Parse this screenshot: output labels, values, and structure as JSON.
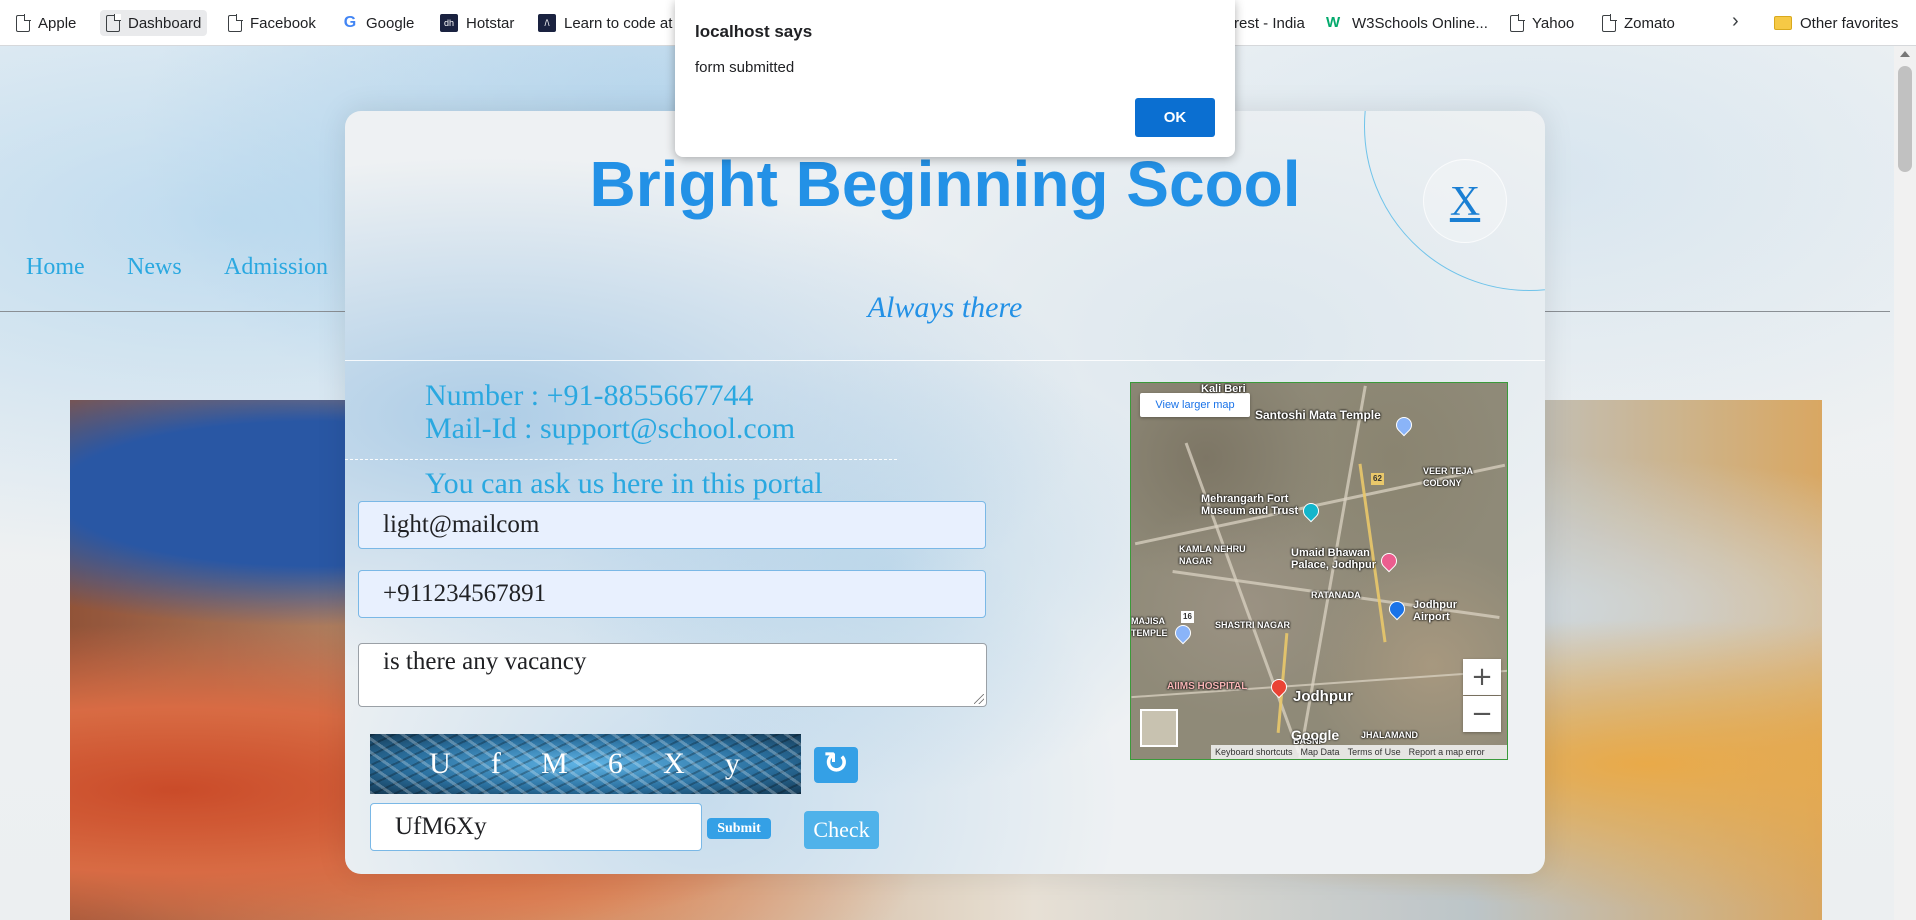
{
  "bookmarks": [
    {
      "label": "Apple",
      "icon": "document-icon"
    },
    {
      "label": "Dashboard",
      "icon": "document-icon"
    },
    {
      "label": "Facebook",
      "icon": "document-icon"
    },
    {
      "label": "Google",
      "icon": "google-icon"
    },
    {
      "label": "Hotstar",
      "icon": "hotstar-icon"
    },
    {
      "label": "Learn to code at",
      "icon": "code-icon"
    },
    {
      "label": "rest - India",
      "icon": ""
    },
    {
      "label": "W3Schools Online...",
      "icon": "w3schools-icon"
    },
    {
      "label": "Yahoo",
      "icon": "document-icon"
    },
    {
      "label": "Zomato",
      "icon": "document-icon"
    }
  ],
  "other_favorites": "Other favorites",
  "nav": {
    "items": [
      "Home",
      "News",
      "Admission"
    ]
  },
  "modal": {
    "title": "Bright Beginning Scool",
    "close_label": "X",
    "tagline": "Always there",
    "contact_number": "Number : +91-8855667744",
    "contact_mail": "Mail-Id : support@school.com",
    "portal_text": "You can ask us here in this portal",
    "email_value": "light@mailcom",
    "phone_value": "+911234567891",
    "question_value": "is there any vacancy",
    "captcha_chars": [
      "U",
      "f",
      "M",
      "6",
      "X",
      "y"
    ],
    "refresh_icon": "refresh-icon",
    "captcha_input_value": "UfM6Xy",
    "submit_label": "Submit",
    "check_label": "Check"
  },
  "map": {
    "view_larger": "View larger map",
    "labels": [
      "Kali Beri",
      "Santoshi Mata Temple",
      "VEER TEJA COLONY",
      "Mehrangarh Fort Museum and Trust",
      "KAMLA NEHRU NAGAR",
      "Umaid Bhawan Palace, Jodhpur",
      "RATANADA",
      "SHASTRI NAGAR",
      "Jodhpur Airport",
      "AIIMS HOSPITAL",
      "Jodhpur",
      "JHALAMAND",
      "BASNI",
      "MAJISA TEMPLE",
      "62",
      "16"
    ],
    "footer": [
      "Keyboard shortcuts",
      "Map Data",
      "Terms of Use",
      "Report a map error"
    ],
    "google": "Google"
  },
  "alert": {
    "title": "localhost says",
    "message": "form submitted",
    "ok_label": "OK"
  },
  "colors": {
    "accent": "#2391e6",
    "link": "#2aa8e0",
    "ok_button": "#0b6fd1"
  }
}
